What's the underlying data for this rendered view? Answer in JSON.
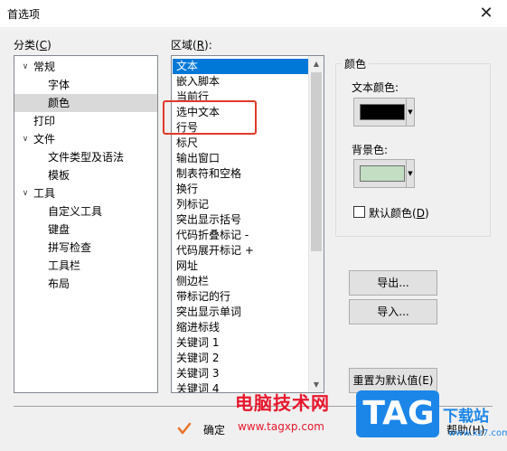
{
  "window": {
    "title": "首选项",
    "close_glyph": "✕"
  },
  "category": {
    "label": "分类(",
    "accel": "C",
    "label_end": ")",
    "items": [
      {
        "text": "常规",
        "level": 0,
        "expanded": true
      },
      {
        "text": "字体",
        "level": 1
      },
      {
        "text": "颜色",
        "level": 1,
        "selected": true
      },
      {
        "text": "打印",
        "level": 0
      },
      {
        "text": "文件",
        "level": 0,
        "expanded": true
      },
      {
        "text": "文件类型及语法",
        "level": 1
      },
      {
        "text": "模板",
        "level": 1
      },
      {
        "text": "工具",
        "level": 0,
        "expanded": true
      },
      {
        "text": "自定义工具",
        "level": 1
      },
      {
        "text": "键盘",
        "level": 1
      },
      {
        "text": "拼写检查",
        "level": 1
      },
      {
        "text": "工具栏",
        "level": 1
      },
      {
        "text": "布局",
        "level": 1
      }
    ]
  },
  "region": {
    "label": "区域(",
    "accel": "R",
    "label_end": "):",
    "items": [
      {
        "text": "文本",
        "selected": true
      },
      {
        "text": "嵌入脚本"
      },
      {
        "text": "当前行"
      },
      {
        "text": "选中文本"
      },
      {
        "text": "行号"
      },
      {
        "text": "标尺"
      },
      {
        "text": "输出窗口"
      },
      {
        "text": "制表符和空格"
      },
      {
        "text": "换行"
      },
      {
        "text": "列标记"
      },
      {
        "text": "突出显示括号"
      },
      {
        "text": "代码折叠标记 -"
      },
      {
        "text": "代码展开标记 +"
      },
      {
        "text": "网址"
      },
      {
        "text": "侧边栏"
      },
      {
        "text": "带标记的行"
      },
      {
        "text": "突出显示单词"
      },
      {
        "text": "缩进标线"
      },
      {
        "text": "关键词 1"
      },
      {
        "text": "关键词 2"
      },
      {
        "text": "关键词 3"
      },
      {
        "text": "关键词 4"
      }
    ]
  },
  "colors": {
    "group_title": "颜色",
    "text_color_label": "文本颜色:",
    "text_color": "#000000",
    "bg_color_label": "背景色:",
    "bg_color": "#c3dec3",
    "default_label": "默认颜色(",
    "default_accel": "D",
    "default_label_end": ")",
    "default_checked": false
  },
  "buttons": {
    "export": "导出...",
    "import": "导入...",
    "reset": "重置为默认值(E)",
    "ok": "确定",
    "help": "帮助(H)"
  },
  "watermark": {
    "site_cn": "电脑技术网",
    "site_url": "www.tagxp.com",
    "tag": "TAG",
    "download": "下载站",
    "download_url": "www.xz7.com"
  },
  "colors_theme": {
    "selection": "#0078d7",
    "highlight_box": "#e0392b",
    "watermark_red": "#e8172d",
    "watermark_blue": "#1c86e8"
  }
}
